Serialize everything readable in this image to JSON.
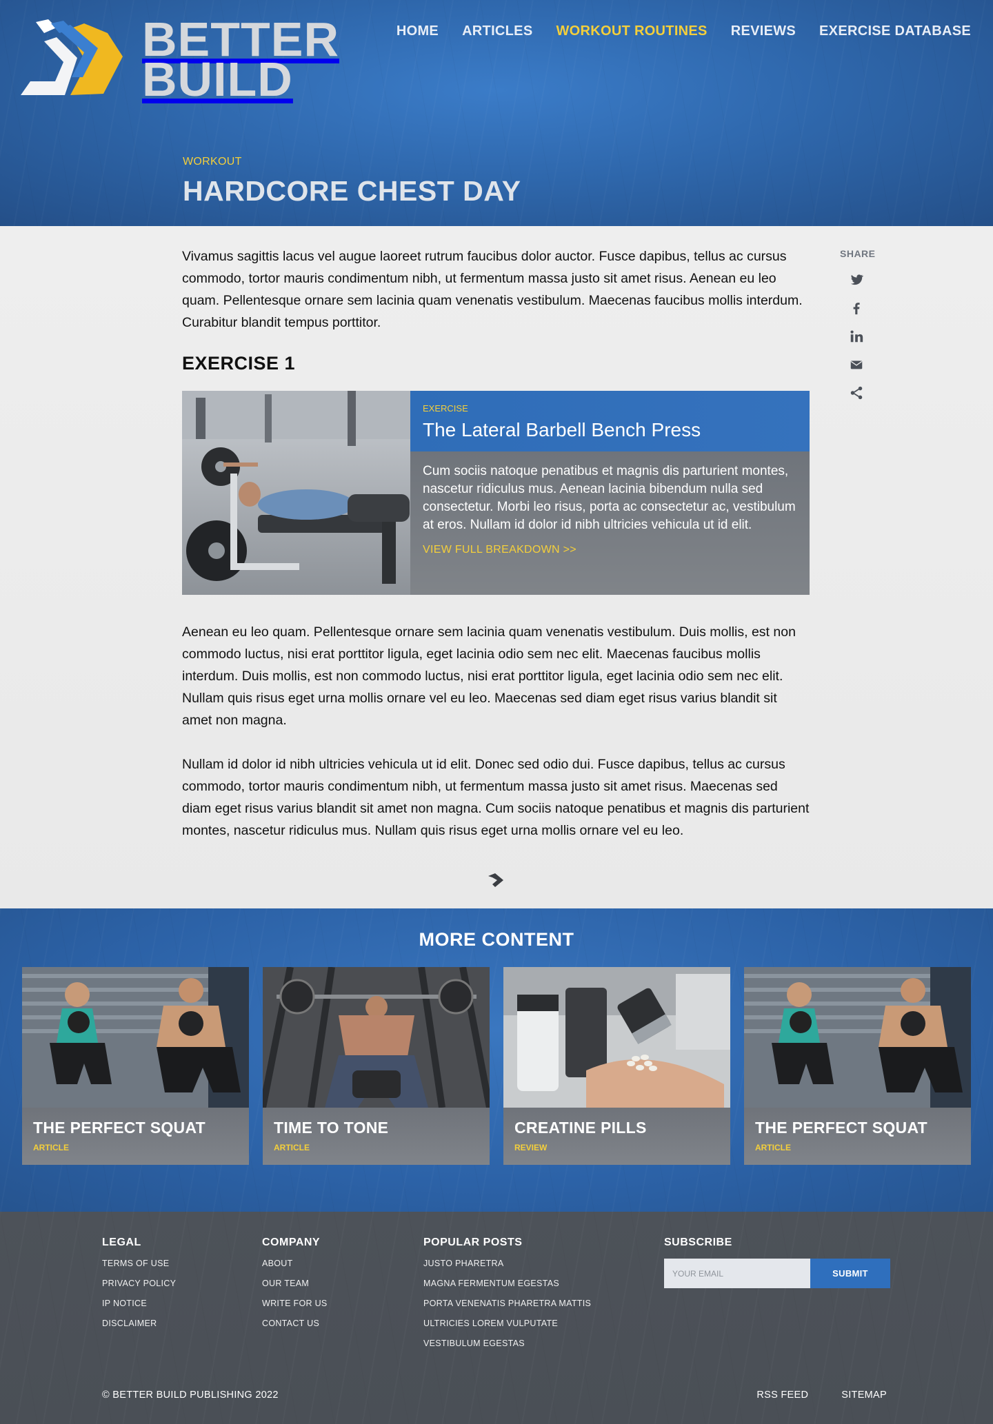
{
  "brand": {
    "line1": "BETTER",
    "line2": "BUILD"
  },
  "nav": [
    {
      "label": "HOME",
      "active": false
    },
    {
      "label": "ARTICLES",
      "active": false
    },
    {
      "label": "WORKOUT ROUTINES",
      "active": true
    },
    {
      "label": "REVIEWS",
      "active": false
    },
    {
      "label": "EXERCISE DATABASE",
      "active": false
    }
  ],
  "hero": {
    "kicker": "WORKOUT",
    "title": "HARDCORE CHEST DAY"
  },
  "share": {
    "label": "SHARE",
    "icons": [
      "twitter-icon",
      "facebook-icon",
      "linkedin-icon",
      "email-icon",
      "share-icon"
    ]
  },
  "article": {
    "intro": "Vivamus sagittis lacus vel augue laoreet rutrum faucibus dolor auctor. Fusce dapibus, tellus ac cursus commodo, tortor mauris condimentum nibh, ut fermentum massa justo sit amet risus. Aenean eu leo quam. Pellentesque ornare sem lacinia quam venenatis vestibulum. Maecenas faucibus mollis interdum. Curabitur blandit tempus porttitor.",
    "exercise_heading": "EXERCISE 1",
    "exercise": {
      "kicker": "EXERCISE",
      "title": "The Lateral Barbell Bench Press",
      "description": "Cum sociis natoque penatibus et magnis dis parturient montes, nascetur ridiculus mus. Aenean lacinia bibendum nulla sed consectetur. Morbi leo risus, porta ac consectetur ac, vestibulum at eros. Nullam id dolor id nibh ultricies vehicula ut id elit.",
      "link": "VIEW FULL BREAKDOWN >>"
    },
    "para2": "Aenean eu leo quam. Pellentesque ornare sem lacinia quam venenatis vestibulum. Duis mollis, est non commodo luctus, nisi erat porttitor ligula, eget lacinia odio sem nec elit. Maecenas faucibus mollis interdum. Duis mollis, est non commodo luctus, nisi erat porttitor ligula, eget lacinia odio sem nec elit. Nullam quis risus eget urna mollis ornare vel eu leo. Maecenas sed diam eget risus varius blandit sit amet non magna.",
    "para3": "Nullam id dolor id nibh ultricies vehicula ut id elit. Donec sed odio dui. Fusce dapibus, tellus ac cursus commodo, tortor mauris condimentum nibh, ut fermentum massa justo sit amet risus. Maecenas sed diam eget risus varius blandit sit amet non magna. Cum sociis natoque penatibus et magnis dis parturient montes, nascetur ridiculus mus. Nullam quis risus eget urna mollis ornare vel eu leo."
  },
  "more": {
    "title": "MORE CONTENT",
    "cards": [
      {
        "title": "THE PERFECT SQUAT",
        "tag": "ARTICLE"
      },
      {
        "title": "TIME TO TONE",
        "tag": "ARTICLE"
      },
      {
        "title": "CREATINE PILLS",
        "tag": "REVIEW"
      },
      {
        "title": "THE PERFECT SQUAT",
        "tag": "ARTICLE"
      }
    ]
  },
  "footer": {
    "legal": {
      "heading": "LEGAL",
      "links": [
        "TERMS OF USE",
        "PRIVACY POLICY",
        "IP NOTICE",
        "DISCLAIMER"
      ]
    },
    "company": {
      "heading": "COMPANY",
      "links": [
        "ABOUT",
        "OUR TEAM",
        "WRITE FOR US",
        "CONTACT US"
      ]
    },
    "popular": {
      "heading": "POPULAR POSTS",
      "links": [
        "JUSTO PHARETRA",
        "MAGNA FERMENTUM EGESTAS",
        "PORTA VENENATIS PHARETRA MATTIS",
        "ULTRICIES LOREM VULPUTATE",
        "VESTIBULUM EGESTAS"
      ]
    },
    "subscribe": {
      "heading": "SUBSCRIBE",
      "placeholder": "YOUR EMAIL",
      "button": "SUBMIT"
    },
    "copyright": "© BETTER BUILD PUBLISHING 2022",
    "bottom_links": [
      "RSS FEED",
      "SITEMAP"
    ]
  },
  "colors": {
    "accent_yellow": "#f4cf3b",
    "brand_blue": "#2f6db8",
    "footer_gray": "#4c5158"
  }
}
